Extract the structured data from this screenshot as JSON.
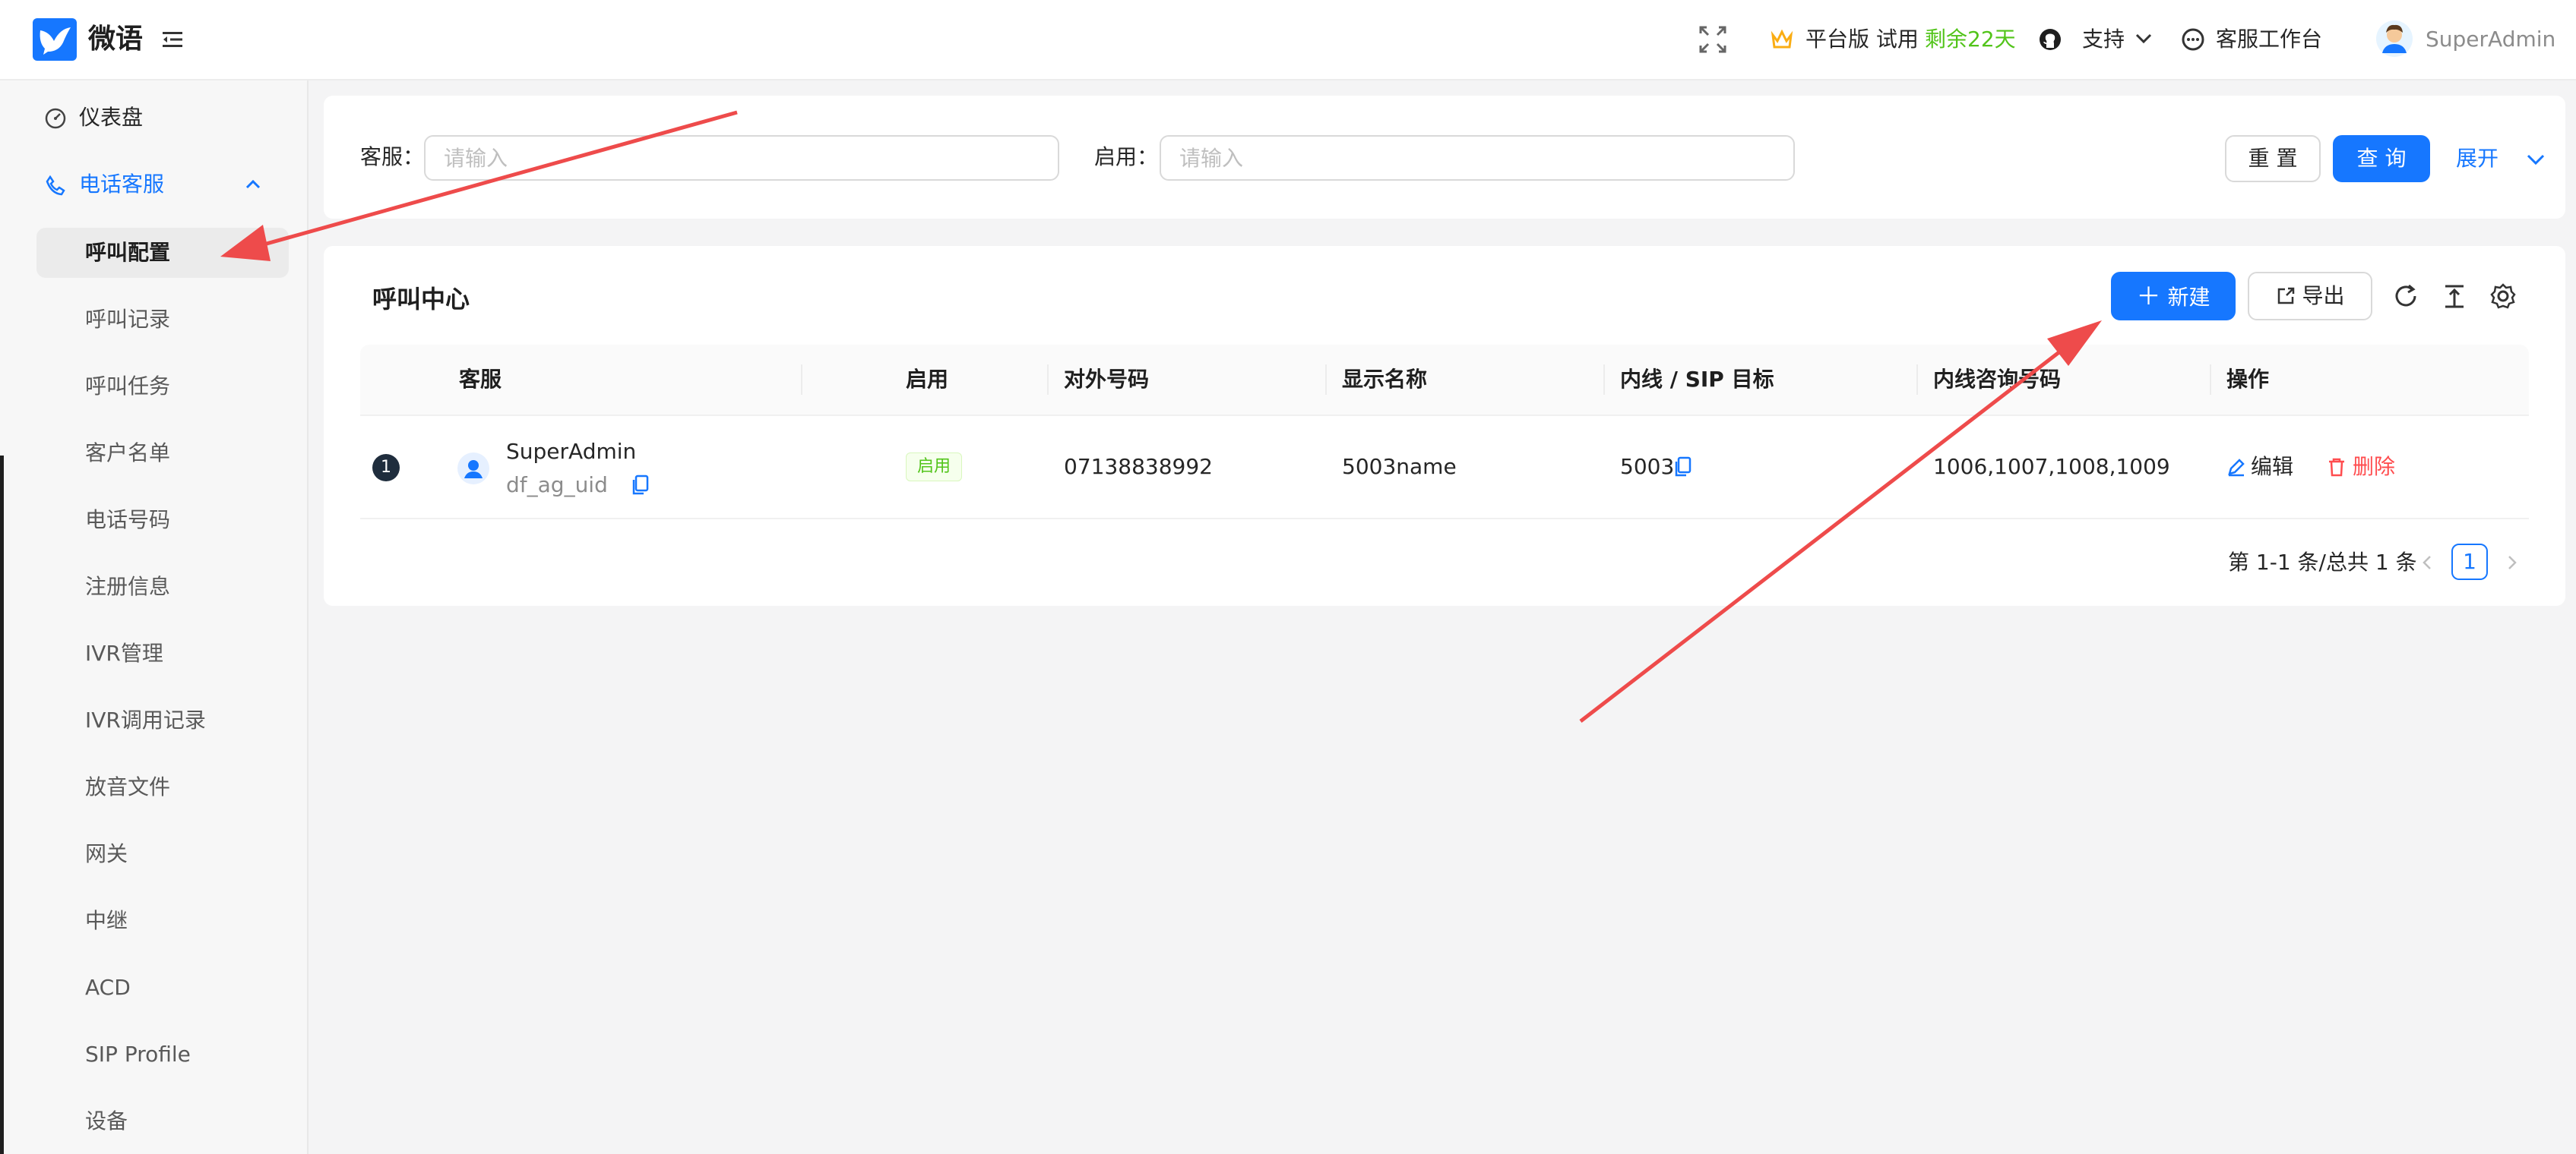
{
  "app": {
    "name": "微语"
  },
  "header": {
    "plan_label": "平台版 试用",
    "trial_remaining": "剩余22天",
    "support_label": "支持",
    "workbench_label": "客服工作台",
    "user_name": "SuperAdmin"
  },
  "sidebar": {
    "dashboard": "仪表盘",
    "phone_service": "电话客服",
    "items": [
      {
        "label": "呼叫配置",
        "active": true
      },
      {
        "label": "呼叫记录"
      },
      {
        "label": "呼叫任务"
      },
      {
        "label": "客户名单"
      },
      {
        "label": "电话号码"
      },
      {
        "label": "注册信息"
      },
      {
        "label": "IVR管理"
      },
      {
        "label": "IVR调用记录"
      },
      {
        "label": "放音文件"
      },
      {
        "label": "网关"
      },
      {
        "label": "中继"
      },
      {
        "label": "ACD"
      },
      {
        "label": "SIP Profile"
      },
      {
        "label": "设备"
      }
    ]
  },
  "search": {
    "agent_label": "客服",
    "agent_placeholder": "请输入",
    "enabled_label": "启用",
    "enabled_placeholder": "请输入",
    "reset_label": "重 置",
    "query_label": "查 询",
    "expand_label": "展开"
  },
  "table": {
    "title": "呼叫中心",
    "new_label": "新建",
    "export_label": "导出",
    "columns": [
      "客服",
      "启用",
      "对外号码",
      "显示名称",
      "内线 / SIP 目标",
      "内线咨询号码",
      "操作"
    ],
    "rows": [
      {
        "index": "1",
        "agent_name": "SuperAdmin",
        "agent_uid": "df_ag_uid",
        "enabled": "启用",
        "outbound_number": "07138838992",
        "display_name": "5003name",
        "extension": "5003",
        "consult_numbers": "1006,1007,1008,1009",
        "edit_label": "编辑",
        "delete_label": "删除"
      }
    ],
    "pagination": {
      "summary": "第 1-1 条/总共 1 条",
      "current_page": "1"
    }
  },
  "colors": {
    "primary": "#1677ff",
    "success": "#52c41a",
    "danger": "#ff4d4f",
    "annotation_arrow": "#ee4b4b"
  }
}
